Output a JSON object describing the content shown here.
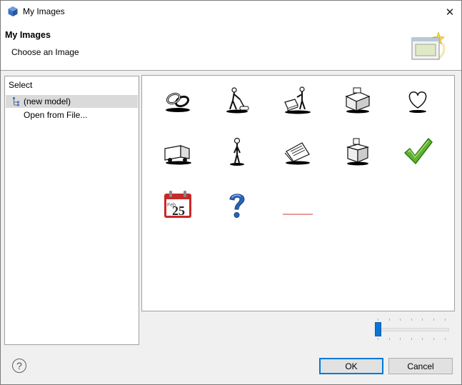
{
  "window": {
    "title": "My Images",
    "close_glyph": "✕"
  },
  "header": {
    "title": "My Images",
    "description": "Choose an Image"
  },
  "left_panel": {
    "title": "Select",
    "items": [
      {
        "label": "(new model)",
        "icon": "model-tree-icon",
        "selected": true
      },
      {
        "label": "Open from File...",
        "icon": "",
        "selected": false
      }
    ]
  },
  "images": [
    {
      "name": "chain-links-icon"
    },
    {
      "name": "person-vacuuming-icon"
    },
    {
      "name": "worker-with-machine-icon"
    },
    {
      "name": "office-equipment-icon"
    },
    {
      "name": "heart-icon"
    },
    {
      "name": "delivery-truck-icon"
    },
    {
      "name": "standing-person-icon"
    },
    {
      "name": "papers-documents-icon"
    },
    {
      "name": "cash-register-icon"
    },
    {
      "name": "green-checkmark-icon",
      "color": "#5fb32f"
    },
    {
      "name": "calendar-icon",
      "text": "Feb",
      "day": "25",
      "color": "#c8282a"
    },
    {
      "name": "question-mark-icon",
      "color": "#2a63b6"
    },
    {
      "name": "red-line-icon",
      "color": "#e27a7a"
    }
  ],
  "zoom_slider": {
    "value": 0,
    "ticks": 8
  },
  "buttons": {
    "ok": "OK",
    "cancel": "Cancel",
    "help": "?"
  }
}
